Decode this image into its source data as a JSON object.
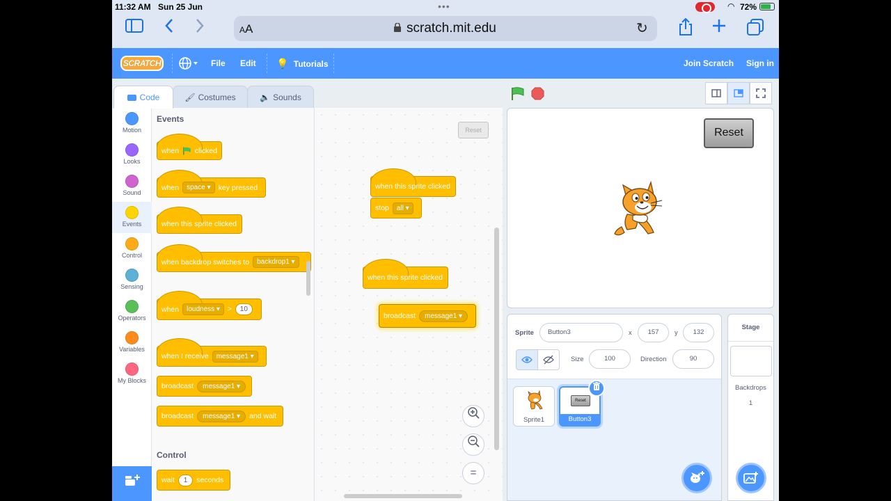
{
  "status": {
    "time": "11:32 AM",
    "date": "Sun 25 Jun",
    "battery": "72%"
  },
  "browser": {
    "aa_label": "A",
    "url": "scratch.mit.edu"
  },
  "menu": {
    "logo": "SCRATCH",
    "file": "File",
    "edit": "Edit",
    "tutorials": "Tutorials",
    "join": "Join Scratch",
    "signin": "Sign in"
  },
  "tabs": {
    "code": "Code",
    "costumes": "Costumes",
    "sounds": "Sounds"
  },
  "categories": [
    {
      "label": "Motion",
      "color": "#4c97ff"
    },
    {
      "label": "Looks",
      "color": "#9966ff"
    },
    {
      "label": "Sound",
      "color": "#cf63cf"
    },
    {
      "label": "Events",
      "color": "#ffd500"
    },
    {
      "label": "Control",
      "color": "#ffab19"
    },
    {
      "label": "Sensing",
      "color": "#5cb1d6"
    },
    {
      "label": "Operators",
      "color": "#59c059"
    },
    {
      "label": "Variables",
      "color": "#ff8c1a"
    },
    {
      "label": "My Blocks",
      "color": "#ff6680"
    }
  ],
  "palette": {
    "events_title": "Events",
    "control_title": "Control",
    "when": "when",
    "clicked": "clicked",
    "key_pressed": "key pressed",
    "space": "space",
    "sprite_clicked": "when this sprite clicked",
    "backdrop_switches": "when backdrop switches to",
    "backdrop1": "backdrop1",
    "loudness": "loudness",
    "gt": ">",
    "ten": "10",
    "i_receive": "when I receive",
    "message1": "message1",
    "broadcast": "broadcast",
    "and_wait": "and wait",
    "wait": "wait",
    "one": "1",
    "seconds": "seconds"
  },
  "workspace": {
    "reset_button": "Reset",
    "script1_hat": "when this sprite clicked",
    "stop": "stop",
    "stop_option": "all",
    "script2_hat": "when this sprite clicked",
    "broadcast": "broadcast",
    "broadcast_msg": "message1",
    "zoom_in": "+",
    "zoom_out": "−",
    "zoom_reset": "="
  },
  "stage": {
    "reset_button": "Reset"
  },
  "sprite_info": {
    "sprite_label": "Sprite",
    "sprite_name": "Button3",
    "x_label": "x",
    "x_value": "157",
    "y_label": "y",
    "y_value": "132",
    "size_label": "Size",
    "size_value": "100",
    "direction_label": "Direction",
    "direction_value": "90"
  },
  "sprites": [
    {
      "name": "Sprite1"
    },
    {
      "name": "Button3",
      "thumb_text": "Reset"
    }
  ],
  "stage_panel": {
    "title": "Stage",
    "backdrops_label": "Backdrops",
    "backdrops_count": "1"
  }
}
